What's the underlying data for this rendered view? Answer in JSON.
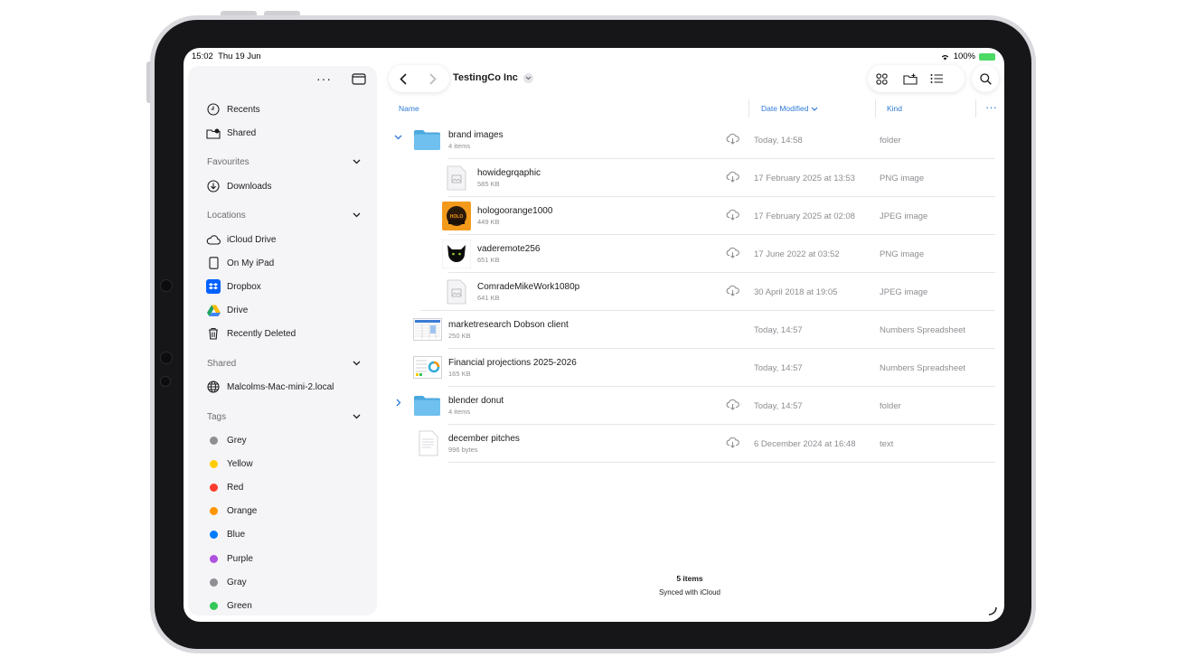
{
  "status_bar": {
    "time": "15:02",
    "date": "Thu 19 Jun",
    "battery": "100%"
  },
  "sidebar": {
    "top_items": [
      {
        "label": "Recents",
        "icon": "clock-icon"
      },
      {
        "label": "Shared",
        "icon": "shared-folder-icon"
      }
    ],
    "favourites": {
      "header": "Favourites",
      "items": [
        {
          "label": "Downloads",
          "icon": "download-icon"
        }
      ]
    },
    "locations": {
      "header": "Locations",
      "items": [
        {
          "label": "iCloud Drive",
          "icon": "cloud-icon"
        },
        {
          "label": "On My iPad",
          "icon": "ipad-icon"
        },
        {
          "label": "Dropbox",
          "icon": "dropbox-icon"
        },
        {
          "label": "Drive",
          "icon": "google-drive-icon"
        },
        {
          "label": "Recently Deleted",
          "icon": "trash-icon"
        }
      ]
    },
    "shared": {
      "header": "Shared",
      "items": [
        {
          "label": "Malcolms-Mac-mini-2.local",
          "icon": "globe-icon"
        }
      ]
    },
    "tags": {
      "header": "Tags",
      "items": [
        {
          "label": "Grey",
          "color": "#8e8e93"
        },
        {
          "label": "Yellow",
          "color": "#ffcc00"
        },
        {
          "label": "Red",
          "color": "#ff3b30"
        },
        {
          "label": "Orange",
          "color": "#ff9500"
        },
        {
          "label": "Blue",
          "color": "#007aff"
        },
        {
          "label": "Purple",
          "color": "#af52de"
        },
        {
          "label": "Gray",
          "color": "#8e8e93"
        },
        {
          "label": "Green",
          "color": "#34c759"
        }
      ]
    }
  },
  "main": {
    "title": "TestingCo Inc",
    "columns": {
      "name": "Name",
      "date": "Date Modified",
      "kind": "Kind"
    },
    "rows": [
      {
        "name": "brand images",
        "sub": "4 items",
        "date": "Today, 14:58",
        "kind": "folder",
        "type": "folder",
        "expanded": true,
        "cloud": true
      },
      {
        "name": "howidegrqaphic",
        "sub": "585 KB",
        "date": "17 February 2025 at 13:53",
        "kind": "PNG image",
        "type": "image",
        "cloud": true
      },
      {
        "name": "hologoorange1000",
        "sub": "449 KB",
        "date": "17 February 2025 at 02:08",
        "kind": "JPEG image",
        "type": "orange-logo",
        "cloud": true
      },
      {
        "name": "vaderemote256",
        "sub": "651 KB",
        "date": "17 June 2022 at 03:52",
        "kind": "PNG image",
        "type": "black-cat",
        "cloud": true
      },
      {
        "name": "ComradeMikeWork1080p",
        "sub": "641 KB",
        "date": "30 April 2018 at 19:05",
        "kind": "JPEG image",
        "type": "image",
        "cloud": true
      },
      {
        "name": "marketresearch Dobson client",
        "sub": "250 KB",
        "date": "Today, 14:57",
        "kind": "Numbers Spreadsheet",
        "type": "sheet",
        "cloud": false
      },
      {
        "name": "Financial projections 2025-2026",
        "sub": "165 KB",
        "date": "Today, 14:57",
        "kind": "Numbers Spreadsheet",
        "type": "sheet2",
        "cloud": false
      },
      {
        "name": "blender donut",
        "sub": "4 items",
        "date": "Today, 14:57",
        "kind": "folder",
        "type": "folder",
        "expanded": false,
        "cloud": true
      },
      {
        "name": "december pitches",
        "sub": "996 bytes",
        "date": "6 December 2024 at 16:48",
        "kind": "text",
        "type": "text",
        "cloud": true
      }
    ],
    "footer": {
      "count": "5 items",
      "sync": "Synced with iCloud"
    }
  },
  "colors": {
    "accent": "#2f7ad6",
    "sidebar_bg": "#f5f5f7",
    "folder": "#5ab4ea"
  }
}
